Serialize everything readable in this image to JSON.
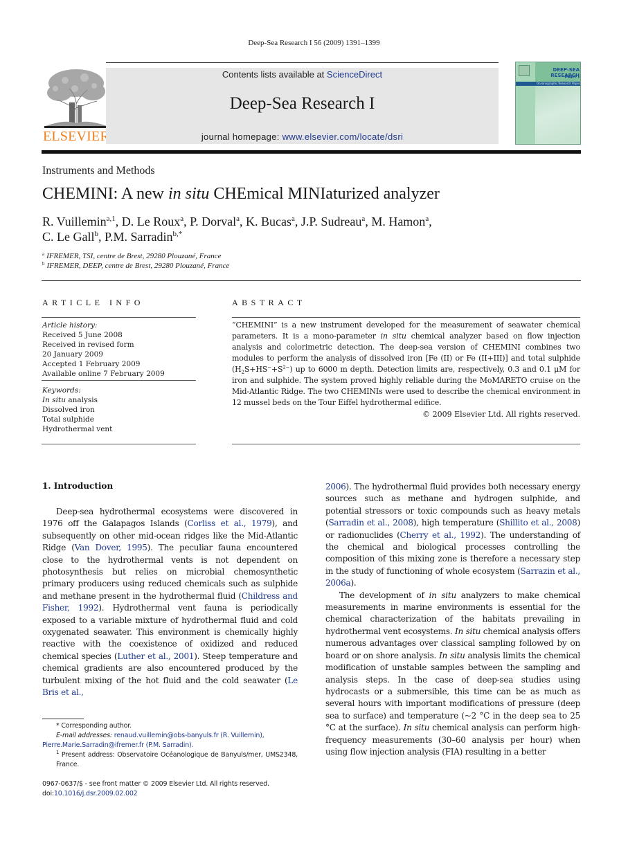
{
  "running_head": "Deep-Sea Research I 56 (2009) 1391–1399",
  "header": {
    "publisher_logo_text": "ELSEVIER",
    "contents_prefix": "Contents lists available at ",
    "contents_link": "ScienceDirect",
    "journal_title": "Deep-Sea Research I",
    "homepage_prefix": "journal homepage: ",
    "homepage_link": "www.elsevier.com/locate/dsri",
    "cover": {
      "title": "DEEP-SEA RESEARCH",
      "part": "PART I",
      "subtitle": "Oceanographic Research Papers"
    },
    "colors": {
      "elsevier_orange": "#f07d1a",
      "link_blue": "#1f3a8f",
      "banner_gray": "#e6e6e6",
      "cover_green": "#7fbf9a"
    }
  },
  "article": {
    "section_type": "Instruments and Methods",
    "title_before": "CHEMINI: A new ",
    "title_italic": "in situ",
    "title_after": " CHEmical MINIaturized analyzer",
    "authors": [
      {
        "name": "R. Vuillemin",
        "sup": "a,1",
        "sep": ", "
      },
      {
        "name": "D. Le Roux",
        "sup": "a",
        "sep": ", "
      },
      {
        "name": "P. Dorval",
        "sup": "a",
        "sep": ", "
      },
      {
        "name": "K. Bucas",
        "sup": "a",
        "sep": ", "
      },
      {
        "name": "J.P. Sudreau",
        "sup": "a",
        "sep": ", "
      },
      {
        "name": "M. Hamon",
        "sup": "a",
        "sep": ","
      },
      {
        "name": "C. Le Gall",
        "sup": "b",
        "sep": ", "
      },
      {
        "name": "P.M. Sarradin",
        "sup": "b,*",
        "sep": ""
      }
    ],
    "affiliations": [
      {
        "key": "a",
        "text": "IFREMER, TSI, centre de Brest, 29280 Plouzané, France"
      },
      {
        "key": "b",
        "text": "IFREMER, DEEP, centre de Brest, 29280 Plouzané, France"
      }
    ]
  },
  "article_info": {
    "heading": "ARTICLE INFO",
    "history_label": "Article history:",
    "history": [
      "Received 5 June 2008",
      "Received in revised form",
      "20 January 2009",
      "Accepted 1 February 2009",
      "Available online 7 February 2009"
    ],
    "keywords_label": "Keywords:",
    "keyword_1_italic": "In situ",
    "keyword_1_rest": " analysis",
    "keywords": [
      "Dissolved iron",
      "Total sulphide",
      "Hydrothermal vent"
    ]
  },
  "abstract": {
    "heading": "ABSTRACT",
    "p1": "“CHEMINI” is a new instrument developed for the measurement of seawater chemical parameters. It is a mono-parameter ",
    "p1_italic": "in situ",
    "p2": " chemical analyzer based on flow injection analysis and colorimetric detection. The deep-sea version of CHEMINI combines two modules to perform the analysis of dissolved iron [Fe (II) or Fe (II+III)] and total sulphide (H",
    "sub2": "2",
    "p3": "S+HS",
    "sup_minus": "−",
    "p4": "+S",
    "sup_2minus": "2−",
    "p5": ") up to 6000 m depth. Detection limits are, respectively, 0.3 and 0.1 μM for iron and sulphide. The system proved highly reliable during the MoMARETO cruise on the Mid-Atlantic Ridge. The two CHEMINIs were used to describe the chemical environment in 12 mussel beds on the Tour Eiffel hydrothermal edifice.",
    "copyright": "© 2009 Elsevier Ltd. All rights reserved."
  },
  "introduction": {
    "heading": "1.  Introduction",
    "left": {
      "t1": "Deep-sea hydrothermal ecosystems were discovered in 1976 off the Galapagos Islands (",
      "c1": "Corliss et al., 1979",
      "t2": "), and subsequently on other mid-ocean ridges like the Mid-Atlantic Ridge (",
      "c2": "Van Dover, 1995",
      "t3": "). The peculiar fauna encountered close to the hydrothermal vents is not dependent on photosynthesis but relies on microbial chemosynthetic primary producers using reduced chemicals such as sulphide and methane present in the hydrothermal fluid (",
      "c3": "Childress and Fisher, 1992",
      "t4": "). Hydrothermal vent fauna is periodically exposed to a variable mixture of hydrothermal fluid and cold oxygenated seawater. This environment is chemically highly reactive with the coexistence of oxidized and reduced chemical species (",
      "c4": "Luther et al., 2001",
      "t5": "). Steep temperature and chemical gradients are also encountered produced by the turbulent mixing of the hot fluid and the cold seawater (",
      "c5": "Le Bris et al.,"
    },
    "right": {
      "c6": "2006",
      "t6": "). The hydrothermal fluid provides both necessary energy sources such as methane and hydrogen sulphide, and potential stressors or toxic compounds such as heavy metals (",
      "c7": "Sarradin et al., 2008",
      "t7": "), high temperature (",
      "c8": "Shillito et al., 2008",
      "t8": ") or radionuclides (",
      "c9": "Cherry et al., 1992",
      "t9": "). The understanding of the chemical and biological processes controlling the composition of this mixing zone is therefore a necessary step in the study of functioning of whole ecosystem (",
      "c10": "Sarrazin et al., 2006a",
      "t10": ").",
      "p2_a": "The development of ",
      "p2_i1": "in situ",
      "p2_b": " analyzers to make chemical measurements in marine environments is essential for the chemical characterization of the habitats prevailing in hydrothermal vent ecosystems. ",
      "p2_i2": "In situ",
      "p2_c": " chemical analysis offers numerous advantages over classical sampling followed by on board or on shore analysis. ",
      "p2_i3": "In situ",
      "p2_d": " analysis limits the chemical modification of unstable samples between the sampling and analysis steps. In the case of deep-sea studies using hydrocasts or a submersible, this time can be as much as several hours with important modifications of pressure (deep sea to surface) and temperature (~2 °C in the deep sea to 25 °C at the surface). ",
      "p2_i4": "In situ",
      "p2_e": " chemical analysis can perform high-frequency measurements (30–60 analysis per hour) when using flow injection analysis (FIA) resulting in a better"
    }
  },
  "footnotes": {
    "corresponding": "* Corresponding author.",
    "email_label": "E-mail addresses:",
    "email1": "renaud.vuillemin@obs-banyuls.fr",
    "email1_name": " (R. Vuillemin),",
    "email2": "Pierre.Marie.Sarradin@ifremer.fr",
    "email2_name": " (P.M. Sarradin).",
    "present_sup": "1",
    "present_address": " Present address: Observatoire Océanologique de Banyuls/mer, UMS2348, France.",
    "front_matter": "0967-0637/$ - see front matter © 2009 Elsevier Ltd. All rights reserved.",
    "doi_prefix": "doi:",
    "doi": "10.1016/j.dsr.2009.02.002"
  }
}
